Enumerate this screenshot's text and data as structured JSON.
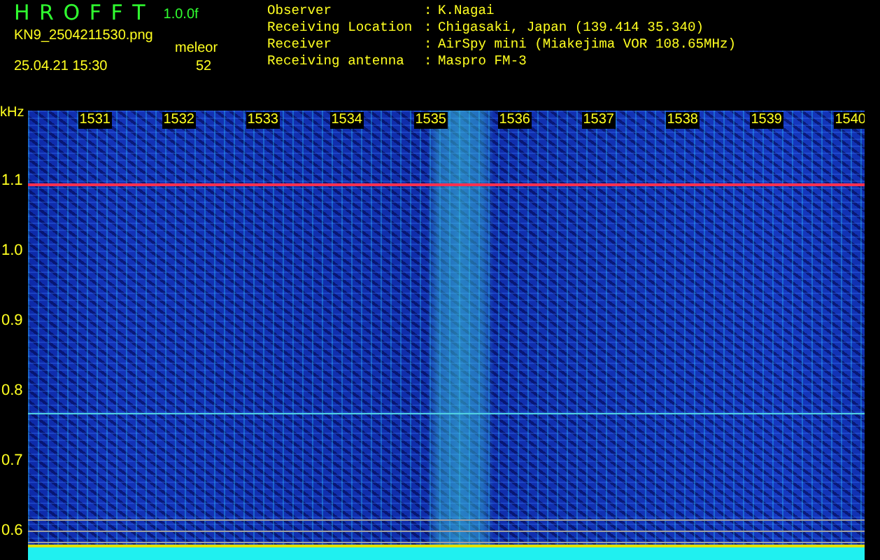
{
  "header": {
    "title": "H R O F F T",
    "version": "1.0.0f",
    "filename": "KN9_2504211530.png",
    "timestamp": "25.04.21 15:30",
    "count_label": "meleor",
    "count": "52"
  },
  "info": [
    {
      "label": "Observer",
      "separator": ":",
      "value": "K.Nagai"
    },
    {
      "label": "Receiving Location",
      "separator": ":",
      "value": "Chigasaki, Japan (139.414 35.340)"
    },
    {
      "label": "Receiver",
      "separator": ":",
      "value": "AirSpy mini (Miakejima VOR 108.65MHz)"
    },
    {
      "label": "Receiving antenna",
      "separator": ":",
      "value": "Maspro FM-3"
    }
  ],
  "spectrogram": {
    "y_unit": "kHz",
    "y_labels": [
      "1.1",
      "1.0",
      "0.9",
      "0.8",
      "0.7",
      "0.6"
    ],
    "x_labels": [
      "1531",
      "1532",
      "1533",
      "1534",
      "1535",
      "1536",
      "1537",
      "1538",
      "1539",
      "1540"
    ]
  }
}
